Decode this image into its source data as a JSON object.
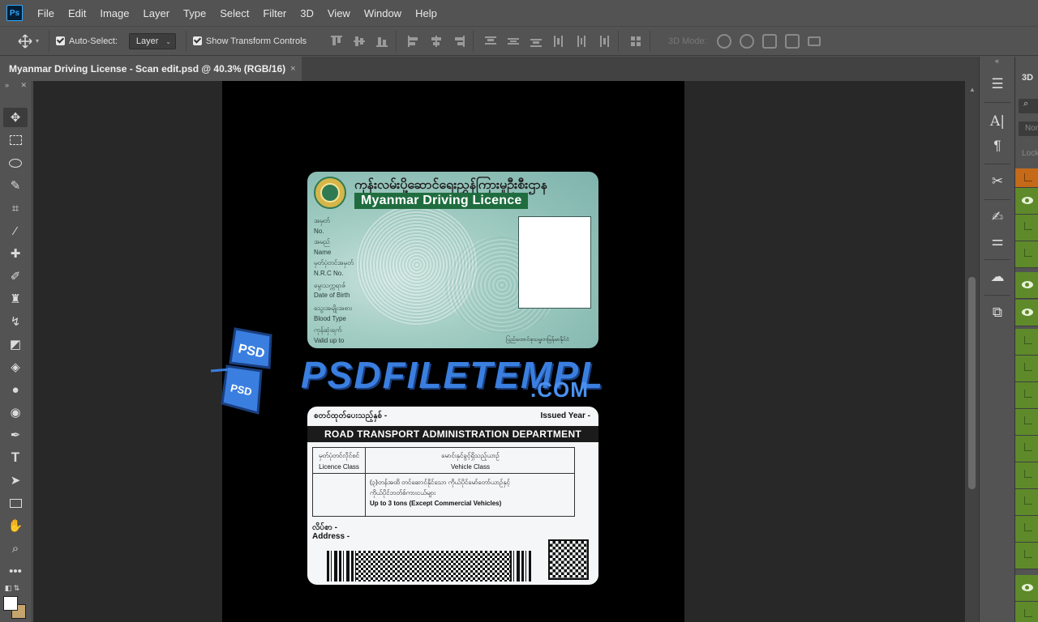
{
  "app": {
    "logo": "Ps"
  },
  "menu": [
    "File",
    "Edit",
    "Image",
    "Layer",
    "Type",
    "Select",
    "Filter",
    "3D",
    "View",
    "Window",
    "Help"
  ],
  "options": {
    "auto_select_label": "Auto-Select:",
    "auto_select_checked": true,
    "auto_select_target": "Layer",
    "show_transform_label": "Show Transform Controls",
    "show_transform_checked": true,
    "mode_3d_label": "3D Mode:"
  },
  "document": {
    "tab_title": "Myanmar Driving License - Scan edit.psd @ 40.3% (RGB/16)",
    "tab_close": "×"
  },
  "card_front": {
    "myanmar_title": "ကုန်းလမ်းပို့ဆောင်ရေးညွှန်ကြားမှုဦးစီးဌာန",
    "english_title": "Myanmar Driving Licence",
    "fields": [
      {
        "label": "အမှတ်"
      },
      {
        "label": "No."
      },
      {
        "label": "အမည်"
      },
      {
        "label": "Name"
      },
      {
        "label": "မှတ်ပုံတင်အမှတ်"
      },
      {
        "label": "N.R.C No."
      },
      {
        "label": "မွေးသက္ကရာဇ်"
      },
      {
        "label": "Date of Birth"
      },
      {
        "label": "သွေးအမျိုးအစား"
      },
      {
        "label": "Blood Type"
      },
      {
        "label": "ကုန်ဆုံးရက်"
      },
      {
        "label": "Valid up to"
      }
    ],
    "signature_note": "ပြည်ထောင်စုသမ္မတမြန်မာနိုင်ငံ"
  },
  "watermark": {
    "text": "PSDFILETEMPL",
    "suffix": ".COM",
    "logo_text_1": "PSD",
    "logo_text_2": "PSD"
  },
  "card_back": {
    "issued_myanmar": "စတင်ထုတ်ပေးသည့်နှစ် -",
    "issued_year": "Issued Year -",
    "department": "ROAD TRANSPORT ADMINISTRATION DEPARTMENT",
    "col1_myanmar": "မှတ်ပုံတင်လိုင်စင်",
    "col1": "Licence Class",
    "col2_myanmar": "မောင်းနှင်ခွင့်ရှိသည့်ယာဉ်",
    "col2": "Vehicle Class",
    "class_myanmar_1": "(၃)တန်အထိ တင်ဆောင်နိုင်သော ကိုယ်ပိုင်မော်တော်ယာဉ်နှင့်",
    "class_myanmar_2": "ကိုယ်ပိုင်ဘတ်စ်ကားငယ်များ",
    "class_english": "Up to 3 tons (Except Commercial Vehicles)",
    "address_myanmar": "လိပ်စာ   -",
    "address": "Address  -"
  },
  "panels": {
    "layers_tab": "3D",
    "search_icon": "⌕",
    "blend_mode": "Nor",
    "lock_label": "Lock"
  },
  "colors": {
    "foreground": "#ffffff",
    "background": "#c6a46d",
    "accent": "#31a8ff"
  }
}
